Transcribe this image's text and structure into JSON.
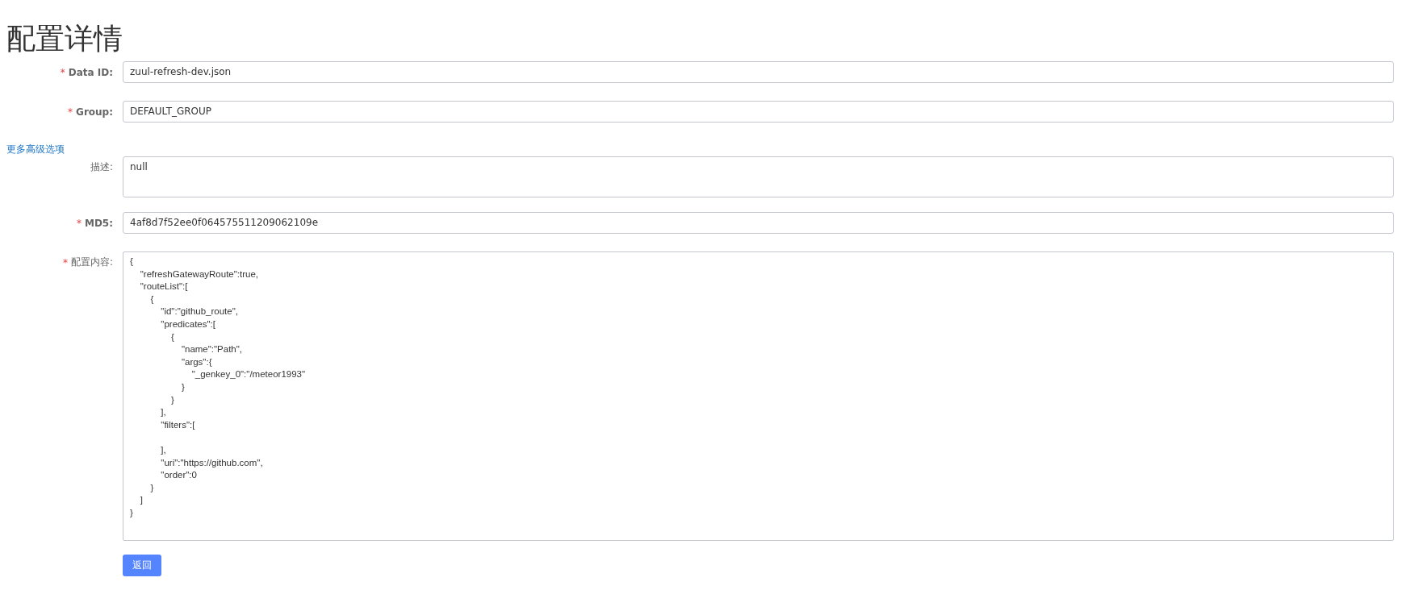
{
  "title": "配置详情",
  "basic_fields": [
    {
      "label": "Data ID:",
      "mark": "*",
      "kind": "input",
      "value": "zuul-refresh-dev.json"
    },
    {
      "label": "Group:",
      "mark": "*",
      "kind": "input",
      "value": "DEFAULT_GROUP"
    }
  ],
  "advanced_link": "更多高级选项",
  "advanced_fields": [
    {
      "label": "描述:",
      "kind": "textarea",
      "value": "null"
    },
    {
      "label": "MD5:",
      "mark": "*",
      "kind": "input",
      "value": "4af8d7f52ee0f064575511209062109e"
    },
    {
      "label": "配置内容:",
      "mark": "*",
      "kind": "code",
      "value": "{\n    \"refreshGatewayRoute\":true,\n    \"routeList\":[\n        {\n            \"id\":\"github_route\",\n            \"predicates\":[\n                {\n                    \"name\":\"Path\",\n                    \"args\":{\n                        \"_genkey_0\":\"/meteor1993\"\n                    }\n                }\n            ],\n            \"filters\":[\n\n            ],\n            \"uri\":\"https://github.com\",\n            \"order\":0\n        }\n    ]\n}"
    }
  ],
  "back_button": "返回"
}
